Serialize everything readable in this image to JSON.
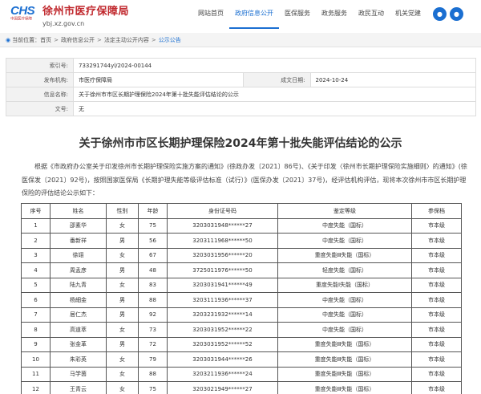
{
  "header": {
    "logo_mark": "CHS",
    "logo_sub": "中国医疗保障",
    "site_name": "徐州市医疗保障局",
    "site_url": "ybj.xz.gov.cn",
    "nav": [
      {
        "label": "网站首页",
        "active": false
      },
      {
        "label": "政府信息公开",
        "active": true
      },
      {
        "label": "医保服务",
        "active": false
      },
      {
        "label": "政务服务",
        "active": false
      },
      {
        "label": "政民互动",
        "active": false
      },
      {
        "label": "机关党建",
        "active": false
      }
    ],
    "icons": [
      "accessibility-icon",
      "user-icon"
    ],
    "accent_color": "#1b6fd1",
    "brand_color": "#c0282d"
  },
  "breadcrumb": {
    "prefix": "当前位置：",
    "items": [
      "首页",
      "政府信息公开",
      "法定主动公开内容",
      "公示公告"
    ],
    "separator": ">"
  },
  "meta": {
    "index_label": "索引号:",
    "index_value": "733291744yl/2024-00144",
    "publisher_label": "发布机构:",
    "publisher_value": "市医疗保障局",
    "date_label": "成文日期:",
    "date_value": "2024-10-24",
    "name_label": "信息名称:",
    "name_value": "关于徐州市市区长期护理保险2024年第十批失能评估结论的公示",
    "doc_no_label": "文号:",
    "doc_no_value": "无"
  },
  "title": "关于徐州市市区长期护理保险2024年第十批失能评估结论的公示",
  "intro": "根据《市政府办公室关于印发徐州市长期护理保险实施方案的通知》(徐政办发〔2021〕86号)、《关于印发〈徐州市长期护理保险实施细则〉的通知》(徐医保发〔2021〕92号)，按照国家医保局《长期护理失能等级评估标准（试行）》(医保办发〔2021〕37号)，经评估机构评估，现将本次徐州市市区长期护理保险的评估结论公示如下：",
  "table": {
    "headers": [
      "序号",
      "姓名",
      "性别",
      "年龄",
      "身份证号码",
      "鉴定等级",
      "参保档"
    ],
    "rows": [
      [
        "1",
        "邵素华",
        "女",
        "75",
        "3203031948******27",
        "中度失能（国标）",
        "市本级"
      ],
      [
        "2",
        "番新祥",
        "男",
        "56",
        "3203111968******50",
        "中度失能（国标）",
        "市本级"
      ],
      [
        "3",
        "徐翊",
        "女",
        "67",
        "3203031956******20",
        "重度失能Ⅲ失能（国标）",
        "市本级"
      ],
      [
        "4",
        "周孟彦",
        "男",
        "48",
        "3725011976******50",
        "轻度失能（国标）",
        "市本级"
      ],
      [
        "5",
        "陆九青",
        "女",
        "83",
        "3203031941******49",
        "重度失能Ⅰ失能（国标）",
        "市本级"
      ],
      [
        "6",
        "杨細金",
        "男",
        "88",
        "3203111936******37",
        "中度失能（国标）",
        "市本级"
      ],
      [
        "7",
        "居仁杰",
        "男",
        "92",
        "3203231932******14",
        "中度失能（国标）",
        "市本级"
      ],
      [
        "8",
        "高道萃",
        "女",
        "73",
        "3203031952******22",
        "中度失能（国标）",
        "市本级"
      ],
      [
        "9",
        "张金革",
        "男",
        "72",
        "3203031952******52",
        "重度失能Ⅲ失能（国标）",
        "市本级"
      ],
      [
        "10",
        "朱彩英",
        "女",
        "79",
        "3203031944******26",
        "重度失能Ⅲ失能（国标）",
        "市本级"
      ],
      [
        "11",
        "马学茵",
        "女",
        "88",
        "3203211936******24",
        "重度失能Ⅲ失能（国标）",
        "市本级"
      ],
      [
        "12",
        "王青云",
        "女",
        "75",
        "3203021949******27",
        "重度失能Ⅲ失能（国标）",
        "市本级"
      ]
    ]
  }
}
